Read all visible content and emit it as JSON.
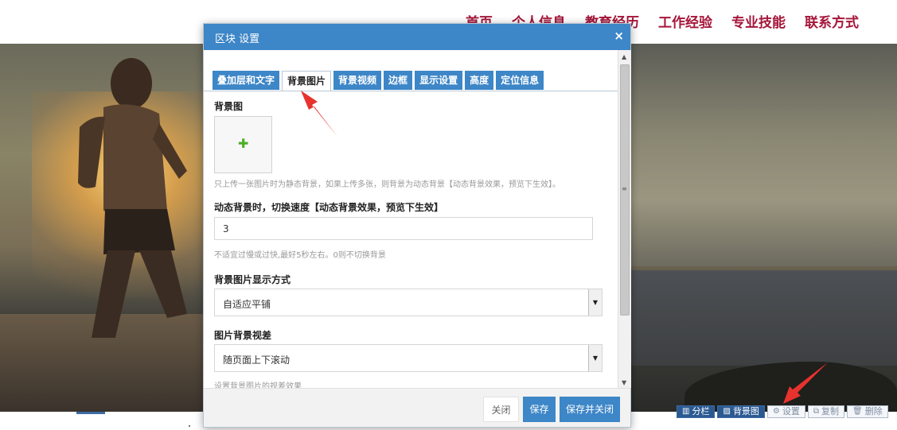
{
  "nav": {
    "items": [
      "首页",
      "个人信息",
      "教育经历",
      "工作经验",
      "专业技能",
      "联系方式"
    ]
  },
  "dialog": {
    "title": "区块 设置",
    "close_glyph": "×",
    "tabs": [
      "叠加层和文字",
      "背景图片",
      "背景视频",
      "边框",
      "显示设置",
      "高度",
      "定位信息"
    ],
    "active_tab": "背景图片",
    "bg_image_label": "背景图",
    "upload_glyph": "✚",
    "bg_image_hint": "只上传一张图片时为静态背景，如果上传多张，则背景为动态背景【动态背景效果，预览下生效】。",
    "speed_label": "动态背景时，切换速度【动态背景效果，预览下生效】",
    "speed_value": "3",
    "speed_hint": "不适宜过慢或过快,最好5秒左右。0则不切换背景",
    "display_label": "背景图片显示方式",
    "display_value": "自适应平铺",
    "parallax_label": "图片背景视差",
    "parallax_value": "随页面上下滚动",
    "parallax_hint": "设置背景图片的视差效果",
    "buttons": {
      "close": "关闭",
      "save": "保存",
      "save_close": "保存并关闭"
    }
  },
  "toolbar": {
    "items": [
      {
        "icon": "columns-icon",
        "label": "分栏"
      },
      {
        "icon": "image-icon",
        "label": "背景图"
      },
      {
        "icon": "gear-icon",
        "label": "设置"
      },
      {
        "icon": "copy-icon",
        "label": "复制"
      },
      {
        "icon": "trash-icon",
        "label": "删除"
      }
    ]
  },
  "colors": {
    "nav_text": "#a5163a",
    "dialog_accent": "#3d86c7",
    "toolbar_dark": "#2b5a92",
    "annotation_arrow": "#e8322e"
  }
}
